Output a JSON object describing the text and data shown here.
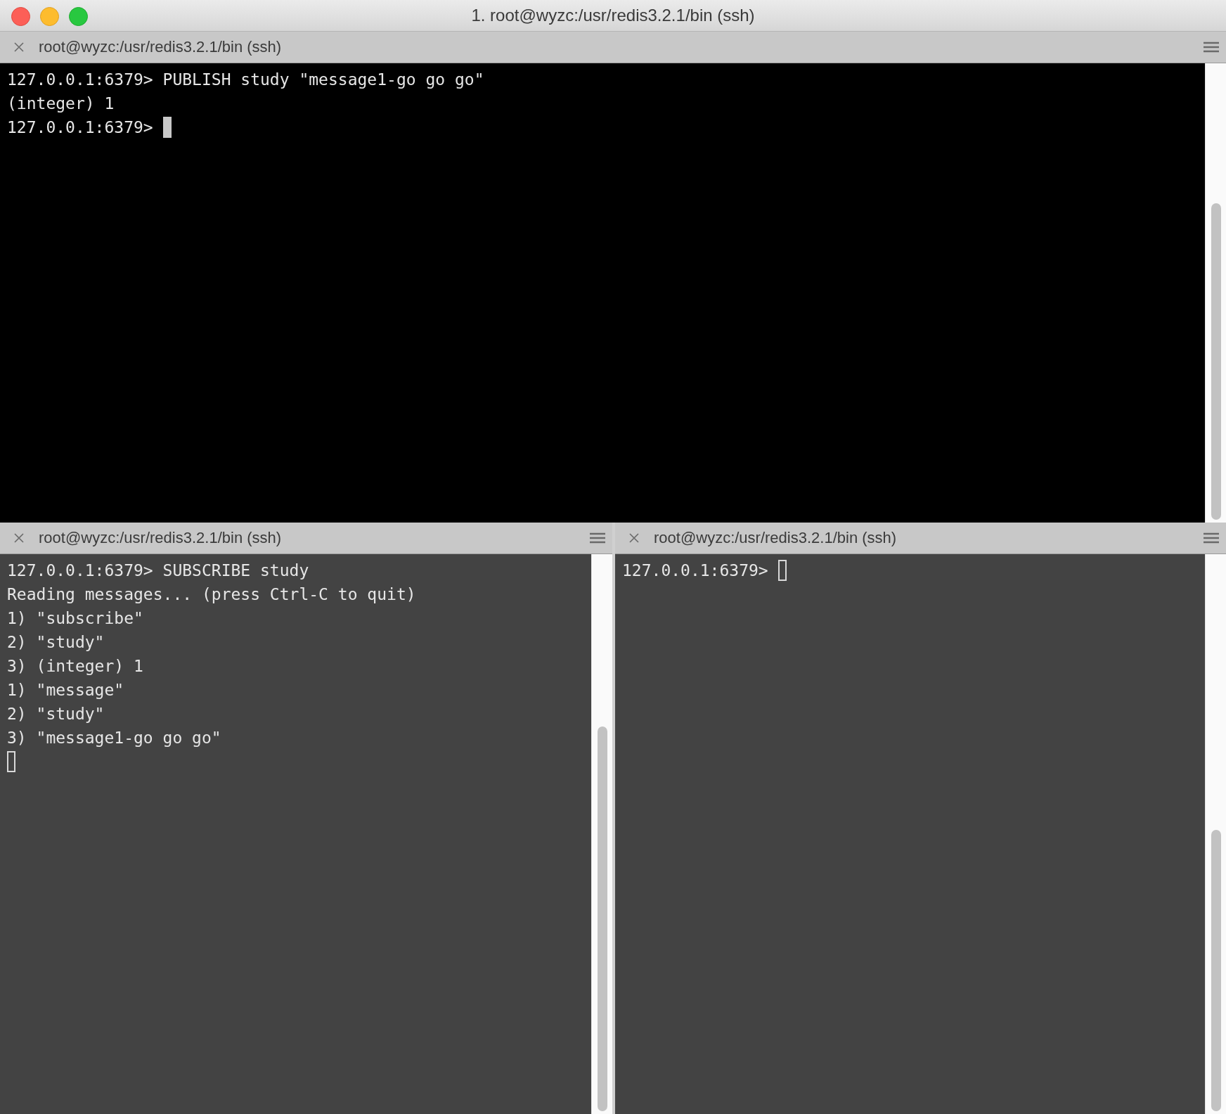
{
  "window": {
    "title": "1. root@wyzc:/usr/redis3.2.1/bin (ssh)"
  },
  "panes": [
    {
      "tab_title": "root@wyzc:/usr/redis3.2.1/bin (ssh)",
      "active": true,
      "lines": [
        "127.0.0.1:6379> PUBLISH study \"message1-go go go\"",
        "(integer) 1"
      ],
      "prompt": "127.0.0.1:6379> "
    },
    {
      "tab_title": "root@wyzc:/usr/redis3.2.1/bin (ssh)",
      "active": false,
      "lines": [
        "127.0.0.1:6379> SUBSCRIBE study",
        "Reading messages... (press Ctrl-C to quit)",
        "1) \"subscribe\"",
        "2) \"study\"",
        "3) (integer) 1",
        "1) \"message\"",
        "2) \"study\"",
        "3) \"message1-go go go\""
      ]
    },
    {
      "tab_title": "root@wyzc:/usr/redis3.2.1/bin (ssh)",
      "active": false,
      "prompt": "127.0.0.1:6379> "
    }
  ]
}
